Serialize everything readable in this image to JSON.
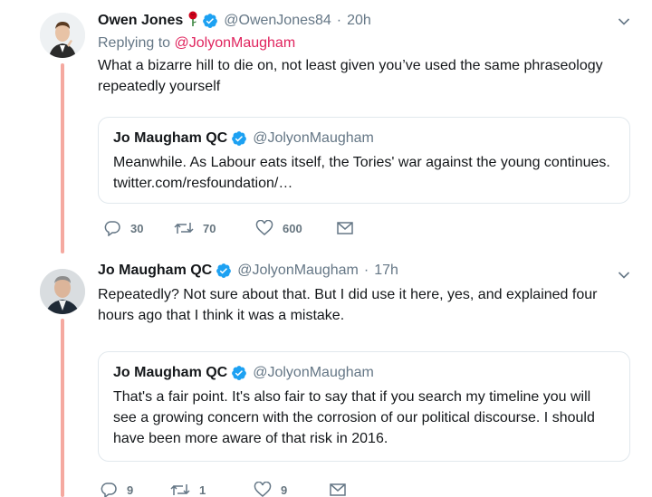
{
  "colors": {
    "accent": "#e0245e",
    "verified": "#1da1f2",
    "thread": "#f5a9a0",
    "muted": "#657786"
  },
  "tweet1": {
    "name": "Owen Jones",
    "handle": "@OwenJones84",
    "time": "20h",
    "reply_label": "Replying to",
    "reply_handle": "@JolyonMaugham",
    "text": "What a bizarre hill to die on, not least given you’ve used the same phraseology repeatedly yourself",
    "quote": {
      "name": "Jo Maugham QC",
      "handle": "@JolyonMaugham",
      "text": "Meanwhile. As Labour eats itself, the Tories' war against the young continues. twitter.com/resfoundation/…"
    },
    "replies": "30",
    "retweets": "70",
    "likes": "600"
  },
  "tweet2": {
    "name": "Jo Maugham QC",
    "handle": "@JolyonMaugham",
    "time": "17h",
    "text": "Repeatedly? Not sure about that. But I did use it here, yes, and explained four hours ago that I think it was a mistake.",
    "quote": {
      "name": "Jo Maugham QC",
      "handle": "@JolyonMaugham",
      "text": "That's a fair point. It's also fair to say that if you search my timeline you will see a growing concern with the corrosion of our political discourse. I should have been more aware of that risk in 2016."
    },
    "replies": "9",
    "retweets": "1",
    "likes": "9"
  }
}
